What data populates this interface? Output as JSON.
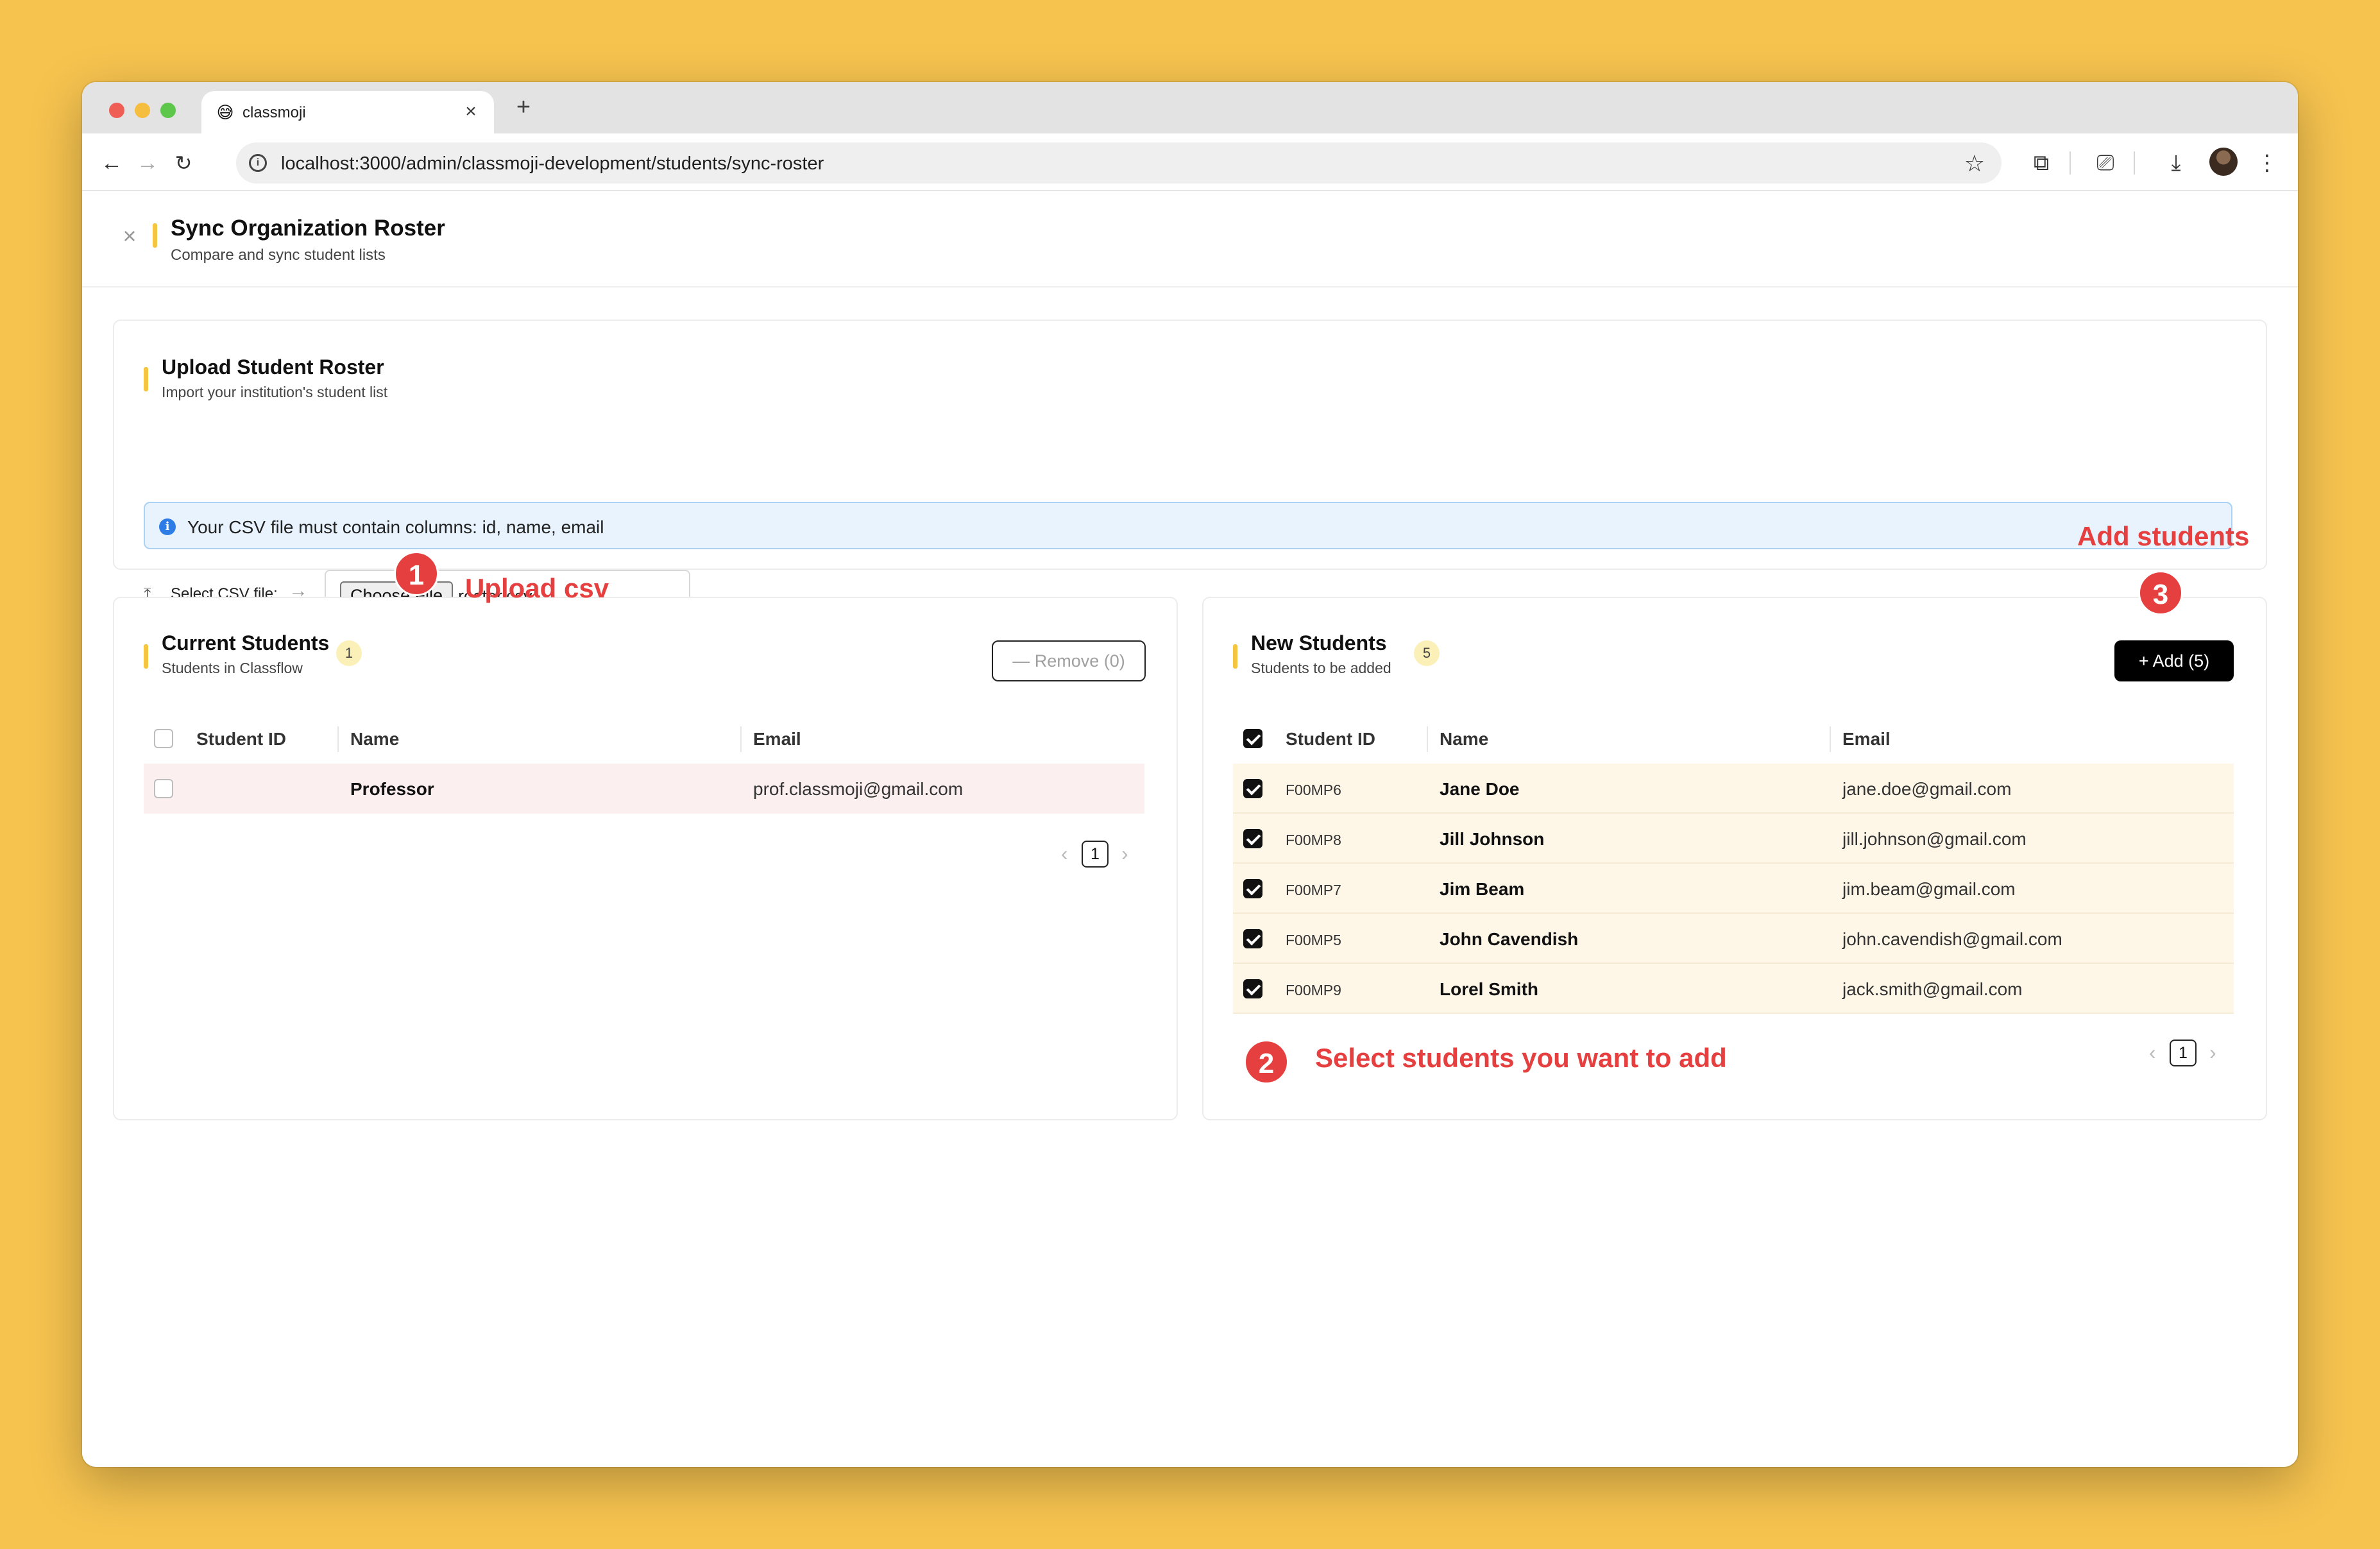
{
  "browser": {
    "tab_title": "classmoji",
    "tab_favicon": "😅",
    "url": "localhost:3000/admin/classmoji-development/students/sync-roster"
  },
  "header": {
    "title": "Sync Organization Roster",
    "subtitle": "Compare and sync student lists"
  },
  "upload": {
    "title": "Upload Student Roster",
    "subtitle": "Import your institution's student list",
    "info_text": "Your CSV file must contain columns: id, name, email",
    "select_label": "Select CSV file:",
    "choose_file_label": "Choose File",
    "file_name": "roster.csv"
  },
  "current_students": {
    "title": "Current Students",
    "subtitle": "Students in Classflow",
    "count": "1",
    "remove_label": "— Remove (0)",
    "columns": [
      "Student ID",
      "Name",
      "Email"
    ],
    "rows": [
      {
        "id": "",
        "name": "Professor",
        "email": "prof.classmoji@gmail.com"
      }
    ],
    "page": "1"
  },
  "new_students": {
    "title": "New Students",
    "subtitle": "Students to be added",
    "count": "5",
    "add_label": "+ Add (5)",
    "columns": [
      "Student ID",
      "Name",
      "Email"
    ],
    "rows": [
      {
        "id": "F00MP6",
        "name": "Jane Doe",
        "email": "jane.doe@gmail.com"
      },
      {
        "id": "F00MP8",
        "name": "Jill Johnson",
        "email": "jill.johnson@gmail.com"
      },
      {
        "id": "F00MP7",
        "name": "Jim Beam",
        "email": "jim.beam@gmail.com"
      },
      {
        "id": "F00MP5",
        "name": "John Cavendish",
        "email": "john.cavendish@gmail.com"
      },
      {
        "id": "F00MP9",
        "name": "Lorel Smith",
        "email": "jack.smith@gmail.com"
      }
    ],
    "page": "1"
  },
  "annotations": {
    "step1_number": "1",
    "step1_text": "Upload csv",
    "step2_number": "2",
    "step2_text": "Select students you want to add",
    "step3_number": "3",
    "step3_text": "Add students"
  },
  "colors": {
    "background": "#F6C34F",
    "accent": "#F5C542",
    "annotation": "#E5403F",
    "info_banner": "#E8F3FD"
  }
}
